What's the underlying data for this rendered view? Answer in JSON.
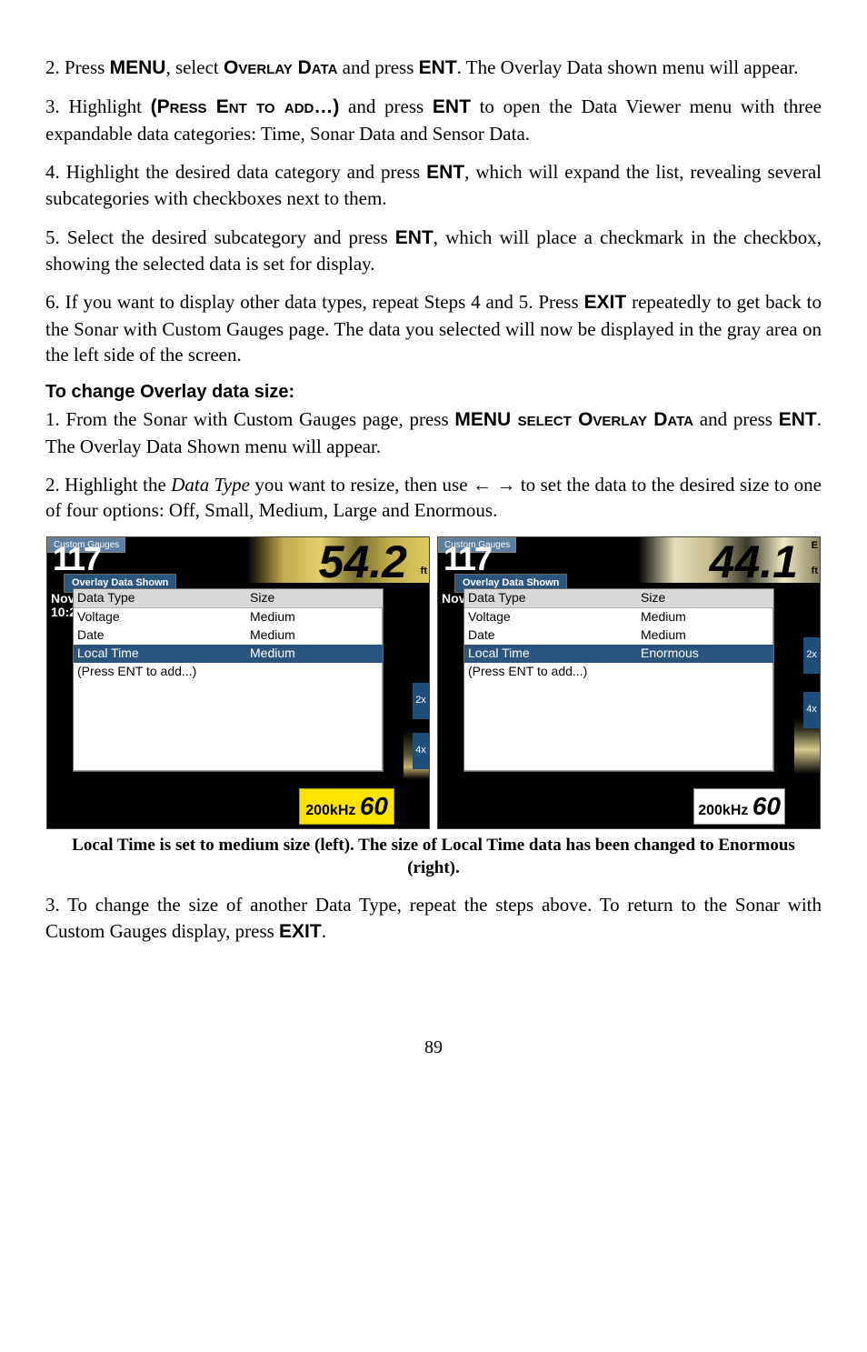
{
  "p1_a": "2. Press ",
  "p1_b": "MENU",
  "p1_c": ", select ",
  "p1_d": "Overlay Data",
  "p1_e": " and press ",
  "p1_f": "ENT",
  "p1_g": ". The Overlay Data shown menu will appear.",
  "p2_a": "3. Highlight ",
  "p2_b": "(Press Ent to add…)",
  "p2_c": " and press ",
  "p2_d": "ENT",
  "p2_e": " to open the Data Viewer menu with three expandable data categories: Time, Sonar Data and Sensor Data.",
  "p3_a": "4. Highlight the desired data category and press ",
  "p3_b": "ENT",
  "p3_c": ", which will expand the list, revealing several subcategories with checkboxes next to them.",
  "p4_a": "5. Select the desired subcategory and press ",
  "p4_b": "ENT",
  "p4_c": ", which will place a checkmark in the checkbox, showing the selected data is set for display.",
  "p5_a": "6. If you want to display other data types, repeat Steps 4 and 5. Press ",
  "p5_b": "EXIT",
  "p5_c": " repeatedly to get back to the Sonar with Custom Gauges page. The data you selected will now be displayed in the gray area on the left side of the screen.",
  "heading1": "To change Overlay data size:",
  "p6_a": "1. From the Sonar with Custom Gauges page, press ",
  "p6_b": "MENU",
  "p6_c": " select Over",
  "p6_c2": "lay Data",
  "p6_d": " and press ",
  "p6_e": "ENT",
  "p6_f": ". The Overlay Data Shown menu will appear.",
  "p7_a": "2. Highlight the ",
  "p7_b": "Data Type",
  "p7_c": " you want to resize, then use ← → to set the data to the desired size to one of four options: Off, Small, Medium, Large and Enormous.",
  "caption": "Local Time is set to medium size (left). The size of Local Time data has been changed to Enormous (right).",
  "p8_a": "3. To change the size of another Data Type, repeat the steps above. To return to the Sonar with Custom Gauges display, press ",
  "p8_b": "EXIT",
  "p8_c": ".",
  "pagenum": "89",
  "screens": {
    "left": {
      "cg": "Custom Gauges",
      "bignum": "117",
      "side1": "Nov",
      "side2": "10:2",
      "ods": "Overlay Data Shown",
      "bigsonar": "54.2",
      "ft": "ft",
      "header_c1": "Data Type",
      "header_c2": "Size",
      "rows": [
        {
          "c1": "Voltage",
          "c2": "Medium"
        },
        {
          "c1": "Date",
          "c2": "Medium"
        },
        {
          "c1": "Local Time",
          "c2": "Medium",
          "sel": true
        },
        {
          "c1": "(Press ENT to add...)",
          "c2": ""
        }
      ],
      "zoom1": "2x",
      "zoom2": "4x",
      "khz": "200kHz",
      "khznum": "60"
    },
    "right": {
      "cg": "Custom Gauges",
      "bignum": "117",
      "side1": "Nov",
      "ods": "Overlay Data Shown",
      "bigsonar": "44.1",
      "ft": "ft",
      "e": "E",
      "header_c1": "Data Type",
      "header_c2": "Size",
      "rows": [
        {
          "c1": "Voltage",
          "c2": "Medium"
        },
        {
          "c1": "Date",
          "c2": "Medium"
        },
        {
          "c1": "Local Time",
          "c2": "Enormous",
          "sel": true
        },
        {
          "c1": "(Press ENT to add...)",
          "c2": ""
        }
      ],
      "zoom1": "2x",
      "zoom2": "4x",
      "khz": "200kHz",
      "khznum": "60"
    }
  }
}
